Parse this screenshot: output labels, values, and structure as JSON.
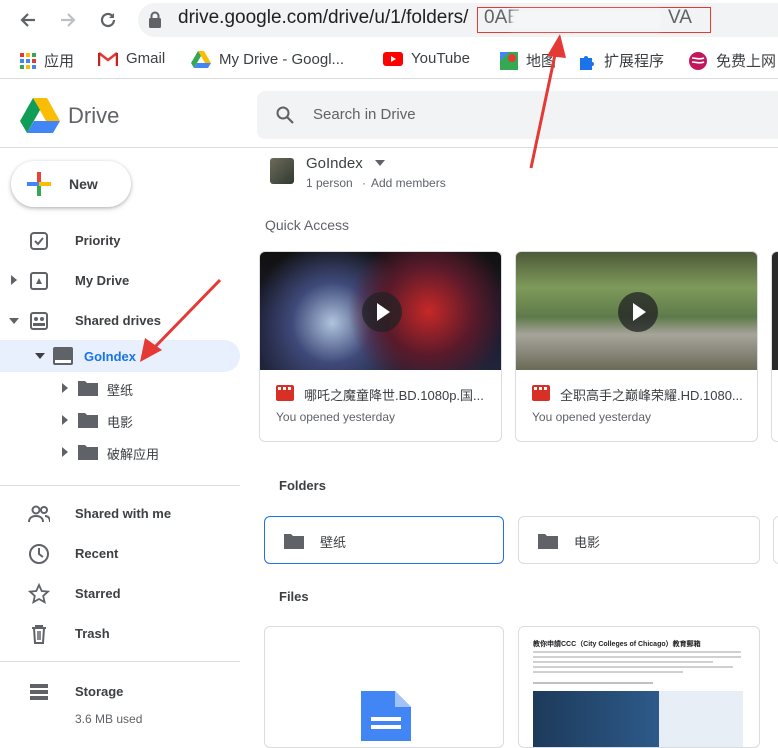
{
  "browser": {
    "url_prefix": "drive.google.com/drive/u/1/folders/",
    "url_folder_id_start": "0AE",
    "url_folder_id_end": "VA"
  },
  "bookmarks": [
    {
      "icon": "apps-grid-icon",
      "label": "应用"
    },
    {
      "icon": "gmail-icon",
      "label": "Gmail"
    },
    {
      "icon": "drive-icon",
      "label": "My Drive - Googl..."
    },
    {
      "icon": "youtube-icon",
      "label": "YouTube"
    },
    {
      "icon": "maps-icon",
      "label": "地图"
    },
    {
      "icon": "puzzle-icon",
      "label": "扩展程序"
    },
    {
      "icon": "shield-icon",
      "label": "免费上网"
    }
  ],
  "drive": {
    "title": "Drive",
    "search_placeholder": "Search in Drive",
    "new_label": "New"
  },
  "sidebar": {
    "priority": "Priority",
    "my_drive": "My Drive",
    "shared_drives": "Shared drives",
    "goindex": "GoIndex",
    "sub_folders": [
      "壁纸",
      "电影",
      "破解应用"
    ],
    "shared_with_me": "Shared with me",
    "recent": "Recent",
    "starred": "Starred",
    "trash": "Trash",
    "storage": "Storage",
    "storage_used": "3.6 MB used"
  },
  "main": {
    "folder_name": "GoIndex",
    "members": "1 person",
    "add_members": "Add members",
    "quick_access": "Quick Access",
    "quick_items": [
      {
        "title": "哪吒之魔童降世.BD.1080p.国...",
        "sub": "You opened yesterday"
      },
      {
        "title": "全职高手之巅峰荣耀.HD.1080...",
        "sub": "You opened yesterday"
      }
    ],
    "folders_label": "Folders",
    "folders": [
      "壁纸",
      "电影"
    ],
    "files_label": "Files",
    "doc_heading": "教你申請CCC（City Colleges of Chicago）教育郵箱"
  },
  "colors": {
    "accent_red": "#e53935",
    "selected_bg": "#e8f0fe",
    "goindex_blue": "#1a73e8"
  }
}
